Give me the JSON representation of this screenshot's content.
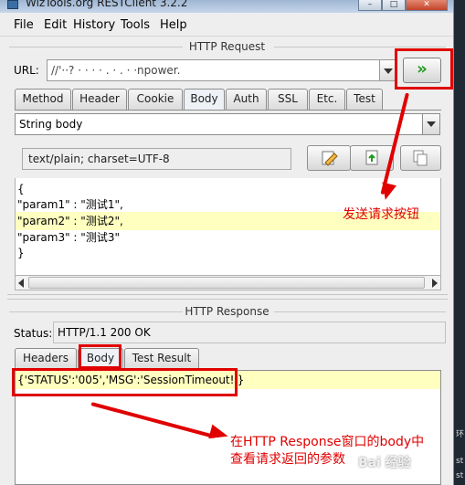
{
  "window": {
    "title": "WizTools.org RESTClient 3.2.2"
  },
  "menu": {
    "items": [
      "File",
      "Edit",
      "History",
      "Tools",
      "Help"
    ]
  },
  "request": {
    "section_title": "HTTP Request",
    "url_label": "URL:",
    "url_value": "//'··?                              ·     ·   ·         ·  .  ·     .  ·  ·npower.",
    "send_glyph": "»",
    "tabs": [
      "Method",
      "Header",
      "Cookie",
      "Body",
      "Auth",
      "SSL",
      "Etc.",
      "Test"
    ],
    "active_tab": "Body",
    "body_type": "String body",
    "content_type": "text/plain; charset=UTF-8",
    "body_lines": [
      "{",
      "\"param1\" : \"测试1\",",
      "\"param2\" : \"测试2\",",
      "\"param3\" : \"测试3\"",
      "}"
    ]
  },
  "response": {
    "section_title": "HTTP Response",
    "status_label": "Status:",
    "status_value": "HTTP/1.1 200 OK",
    "tabs": [
      "Headers",
      "Body",
      "Test Result"
    ],
    "active_tab": "Body",
    "body_text": "{'STATUS':'005','MSG':'SessionTimeout!'}"
  },
  "annotations": {
    "send_note": "发送请求按钮",
    "response_note_line1": "在HTTP Response窗口的body中",
    "response_note_line2": "查看请求返回的参数",
    "color": "#e00000"
  },
  "watermark": "Bai 经验",
  "side_letters": [
    "环",
    "st",
    "st"
  ]
}
